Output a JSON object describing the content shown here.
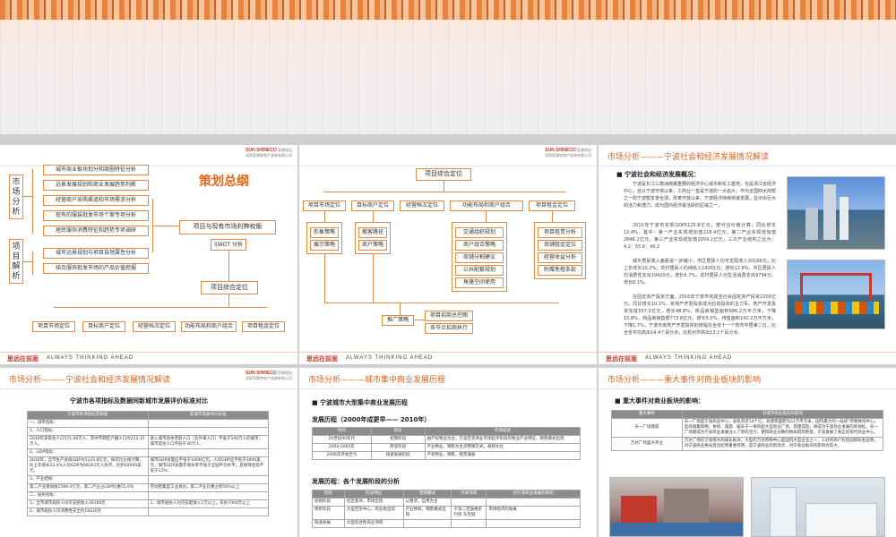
{
  "common": {
    "brand": "思远在前面",
    "slogan": "ALWAYS THINKING AHEAD",
    "logo_en": "SUN SHINECO",
    "logo_cn": "思源经纪",
    "logo_sub": "深圳思源房地产咨询有限公司"
  },
  "slide1": {
    "left_group_1": "市场分析",
    "left_group_2": "项目解析",
    "items_1": [
      "城市商业板块划分和商圈特征分析",
      "远景发展规划和商业发展趋势判断",
      "经营商户采购渠道和市场需求分析",
      "现有的服装批发市场个案专项分析",
      "居民服饰消费特征和趋势专项调研"
    ],
    "items_2": [
      "城市远景规划与项目自然属性分析",
      "结合服饰批发市场的产品价值挖掘"
    ],
    "title": "策划总纲",
    "center_box": "项目与现有市场利弊权衡",
    "swot": "SWOT 分析",
    "core": "项目综合定位",
    "bottom_boxes": [
      "项目市场定位",
      "目标商户定位",
      "经营档次定位",
      "功能布局和商户组合",
      "项目租金定位"
    ]
  },
  "slide2": {
    "top": "项目综合定位",
    "row": [
      "项目市场定位",
      "目标商户定位",
      "经营档次定位",
      "功能布局和商户组合",
      "项目租金定位"
    ],
    "col1": [
      "形象策略",
      "展示策略"
    ],
    "col2": [
      "搬客路径",
      "商户策略"
    ],
    "col3": [
      "交通组织规划",
      "商户组合策略",
      "商铺分割建议",
      "公共配套规划",
      "角落空间使用"
    ],
    "col4": [
      "项目租赁分析",
      "商铺租金定位",
      "经营收益分析",
      "附赠免租条款"
    ],
    "bottom": "推广策略",
    "bottom_right": [
      "项目招商总控图",
      "各节点招商执行"
    ]
  },
  "slide3": {
    "title": "市场分析———宁波社会和经济发展情况解读",
    "bullet": "宁波社会和经济发展概况：",
    "para1": "宁波是长江三角洲南翼重要的经济中心城市和化工基地，也是浙江省经济中心，自从宁波开埠以来，工商业一直是宁波的一大名片。作为全国四大商帮之一的宁波帮享誉全球，改革开放以来，宁波经济持续快速发展，显示出巨大的活力和潜力，成为国内经济最活跃的区域之一。",
    "para2": "2010年宁波市实现GDP5125.8亿元，按可比价格计算，同比增长12.4%，其中：第一产业实现增加值218.4亿元，第二产业实现增加值2848.2亿元，第三产业实现增加值2059.2亿元，三次产业结构之比为： 4.2：55.6：40.2",
    "para3": "城乡居民收入差距进一步缩小，市区居民人均可支配收入30166元，比上年增长10.2%；农村居民人均纯收入14261元，增长12.8%，市区居民人均消费性支出19420元，增长6.7%。农村居民人均生活消费支出9794元，增长8.1%。",
    "para4": "在固定资产投资方面，2010年宁波市完成全社会固定资产投资2200亿元，同比增长10.1%，房地产开发投资成为拉动投资的主力军，地产开发投资完成557.3亿元，增长48.8%，商品房销售面积686.2万平方米，下降15.8%，商品房销售额773.8亿元，增长5.0%，待售面积142.2万平方米，下降1.7%，宁波市房地产开发投资的增幅在全省十一个地市中居第二位，比全省平均高出14.4个百分点，比杭州市高出13.1个百分点。"
  },
  "slide4": {
    "title": "市场分析———宁波社会和经济发展情况解读",
    "table_title": "宁波市各项指标及数据同新城市发展评价标准对比",
    "headers": [
      "宁波市各项指标及数据",
      "新城市发展评价标准"
    ],
    "rows": [
      [
        "一、城市指标：",
        ""
      ],
      [
        "1、人口指标：",
        ""
      ],
      [
        "2010年末常住人口571.06万人，其中市辖区户籍人口为223.35万人。",
        "进入城市总体老龄人口（含外来人口）不低于100万人的城市；城市常住人口不低于30万人；"
      ],
      [
        "2、GDP指标：",
        ""
      ],
      [
        "2010年，全市生产总值GDP为5125.8亿元，按可比价格计算，比上年增长12.4%人均GDP为68162元人民币，达到10000美元。",
        "城市GDP总量应不低于1000亿元，人均GDP应不低于3000美元，城市GDP总量年增长率不低于全国平均水平，且保持连续不低于12%；"
      ],
      [
        "3、产业结构：",
        ""
      ],
      [
        "第二产业增加值2589.4亿元，第二产业占GDP比重55.6%",
        "劳动密集型工业发达，第二产业比重占到50%以上"
      ],
      [
        "二、居民指标：",
        ""
      ],
      [
        "1、全市城市居民人均可支配收入30166元",
        "1、城市居民人均可支配收入1万以上，农民7000元以上"
      ],
      [
        "2、城市居民人均消费性支出为19420元",
        ""
      ]
    ]
  },
  "slide5": {
    "title": "市场分析———城市集中商业发展历程",
    "bullet": "宁波城市大型集中商业发展历程",
    "sub1": "发展历程（2000年成更早—— 2010年）",
    "t1_headers": [
      "时间",
      "阶段",
      "市场描述"
    ],
    "t1_rows": [
      [
        "20世纪90年代",
        "初期阶段",
        "由产权物业为主，宁波百货商业市场起步阶段的物业产业特征，销售模式出现"
      ],
      [
        "2000-2005年",
        "转变阶段",
        "产业物业，销售为主流营销方式，规则文化"
      ],
      [
        "2006年开始至今",
        "快速发展阶段",
        "产权物业，销售，租赁兼备"
      ]
    ],
    "sub2": "发展历程：各个发展阶段的分析",
    "t2_headers": [
      "阶段",
      "阶段特征",
      "营销模式",
      "代表项目",
      "对宁波商业发展的影响"
    ],
    "t2_rows": [
      [
        "初始阶段",
        "社区底商，市场出现",
        "以租赁，自用为主",
        "",
        ""
      ],
      [
        "转折阶段",
        "大型百货中心，商业街出现",
        "产业物权，销售模式出现",
        "宁波二百鼓楼步行街 东至城",
        "市场经济的发展"
      ],
      [
        "快速发展",
        "大型综合性商业项目",
        "",
        "",
        ""
      ]
    ]
  },
  "slide6": {
    "title": "市场分析———重大事件对商业板块的影响",
    "bullet": "重大事件对商业板块的影响：",
    "headers": [
      "重大事件",
      "对城市商业板块的影响"
    ],
    "rows": [
      [
        "天一广场建成",
        "天一广场是宁波商业中心，总投资近14个亿，总建筑面积为22万平方米，国内最大的一站式“购物休闲中心，是商城集购物、休闲、旅游、娱乐于一体的超大型商业广场，其建成后，将成为宁波商业发展的新地标。天一广场建成为宁波商业发展注入了新的活力，使得商业分散的格局得到改变，宁波发展了真正的现代商业中心。"
      ],
      [
        "万达广场盛大开业",
        "万达广场在宁波南大的城东板块，大型的万达购物中心是国内大型企业之一，入驻的商户包括国际知名品牌，对宁波商业格局变化起到重要作用，是宁波商业的新亮点，对于商业板块的影响也较大。"
      ]
    ]
  }
}
